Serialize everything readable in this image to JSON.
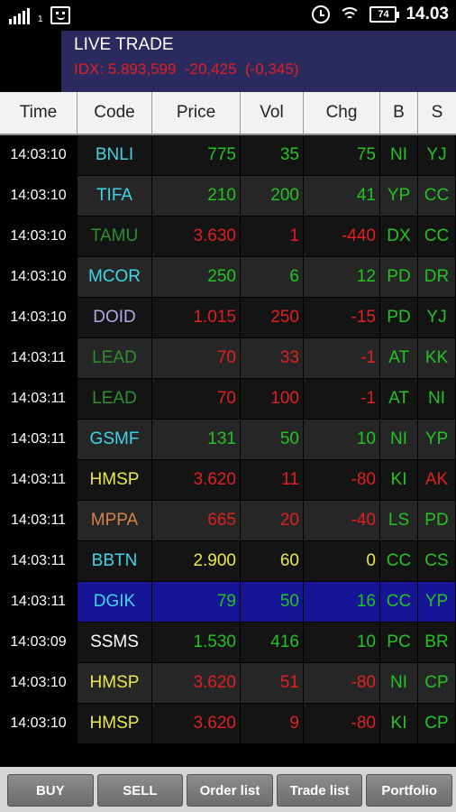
{
  "status_bar": {
    "signal_sub": "1",
    "battery": "74",
    "time": "14.03"
  },
  "header": {
    "title": "LIVE TRADE",
    "idx": "IDX: 5.893,599  -20,425  (-0,345)"
  },
  "columns": [
    "Time",
    "Code",
    "Price",
    "Vol",
    "Chg",
    "B",
    "S"
  ],
  "colors": {
    "green": "#22c322",
    "red": "#e02020",
    "yellow": "#e8e84a",
    "cyan": "#3ed6e6",
    "dark_green": "#2f8f2f",
    "lavender": "#b4a8ea",
    "orange": "#d4824a",
    "white": "#ffffff",
    "header_bg": "#2b2a5e",
    "highlight": "#151596"
  },
  "rows": [
    {
      "time": "14:03:10",
      "code": "BNLI",
      "code_color": "cyan",
      "price": "775",
      "vol": "35",
      "chg": "75",
      "num_color": "green",
      "b": "NI",
      "s": "YJ",
      "s_color": "green"
    },
    {
      "time": "14:03:10",
      "code": "TIFA",
      "code_color": "cyan",
      "price": "210",
      "vol": "200",
      "chg": "41",
      "num_color": "green",
      "b": "YP",
      "s": "CC",
      "s_color": "green"
    },
    {
      "time": "14:03:10",
      "code": "TAMU",
      "code_color": "dark_green",
      "price": "3.630",
      "vol": "1",
      "chg": "-440",
      "num_color": "red",
      "b": "DX",
      "s": "CC",
      "s_color": "green"
    },
    {
      "time": "14:03:10",
      "code": "MCOR",
      "code_color": "cyan",
      "price": "250",
      "vol": "6",
      "chg": "12",
      "num_color": "green",
      "b": "PD",
      "s": "DR",
      "s_color": "green"
    },
    {
      "time": "14:03:10",
      "code": "DOID",
      "code_color": "lavender",
      "price": "1.015",
      "vol": "250",
      "chg": "-15",
      "num_color": "red",
      "b": "PD",
      "s": "YJ",
      "s_color": "green"
    },
    {
      "time": "14:03:11",
      "code": "LEAD",
      "code_color": "dark_green",
      "price": "70",
      "vol": "33",
      "chg": "-1",
      "num_color": "red",
      "b": "AT",
      "s": "KK",
      "s_color": "green"
    },
    {
      "time": "14:03:11",
      "code": "LEAD",
      "code_color": "dark_green",
      "price": "70",
      "vol": "100",
      "chg": "-1",
      "num_color": "red",
      "b": "AT",
      "s": "NI",
      "s_color": "green"
    },
    {
      "time": "14:03:11",
      "code": "GSMF",
      "code_color": "cyan",
      "price": "131",
      "vol": "50",
      "chg": "10",
      "num_color": "green",
      "b": "NI",
      "s": "YP",
      "s_color": "green"
    },
    {
      "time": "14:03:11",
      "code": "HMSP",
      "code_color": "yellow",
      "price": "3.620",
      "vol": "11",
      "chg": "-80",
      "num_color": "red",
      "b": "KI",
      "s": "AK",
      "s_color": "red"
    },
    {
      "time": "14:03:11",
      "code": "MPPA",
      "code_color": "orange",
      "price": "665",
      "vol": "20",
      "chg": "-40",
      "num_color": "red",
      "b": "LS",
      "s": "PD",
      "s_color": "green"
    },
    {
      "time": "14:03:11",
      "code": "BBTN",
      "code_color": "cyan",
      "price": "2.900",
      "vol": "60",
      "chg": "0",
      "num_color": "yellow",
      "b": "CC",
      "s": "CS",
      "s_color": "green"
    },
    {
      "time": "14:03:11",
      "code": "DGIK",
      "code_color": "cyan",
      "price": "79",
      "vol": "50",
      "chg": "16",
      "num_color": "green",
      "b": "CC",
      "s": "YP",
      "s_color": "green",
      "highlight": true
    },
    {
      "time": "14:03:09",
      "code": "SSMS",
      "code_color": "white",
      "price": "1.530",
      "vol": "416",
      "chg": "10",
      "num_color": "green",
      "b": "PC",
      "s": "BR",
      "s_color": "green"
    },
    {
      "time": "14:03:10",
      "code": "HMSP",
      "code_color": "yellow",
      "price": "3.620",
      "vol": "51",
      "chg": "-80",
      "num_color": "red",
      "b": "NI",
      "s": "CP",
      "s_color": "green"
    },
    {
      "time": "14:03:10",
      "code": "HMSP",
      "code_color": "yellow",
      "price": "3.620",
      "vol": "9",
      "chg": "-80",
      "num_color": "red",
      "b": "KI",
      "s": "CP",
      "s_color": "green"
    }
  ],
  "buttons": [
    "BUY",
    "SELL",
    "Order list",
    "Trade list",
    "Portfolio"
  ]
}
